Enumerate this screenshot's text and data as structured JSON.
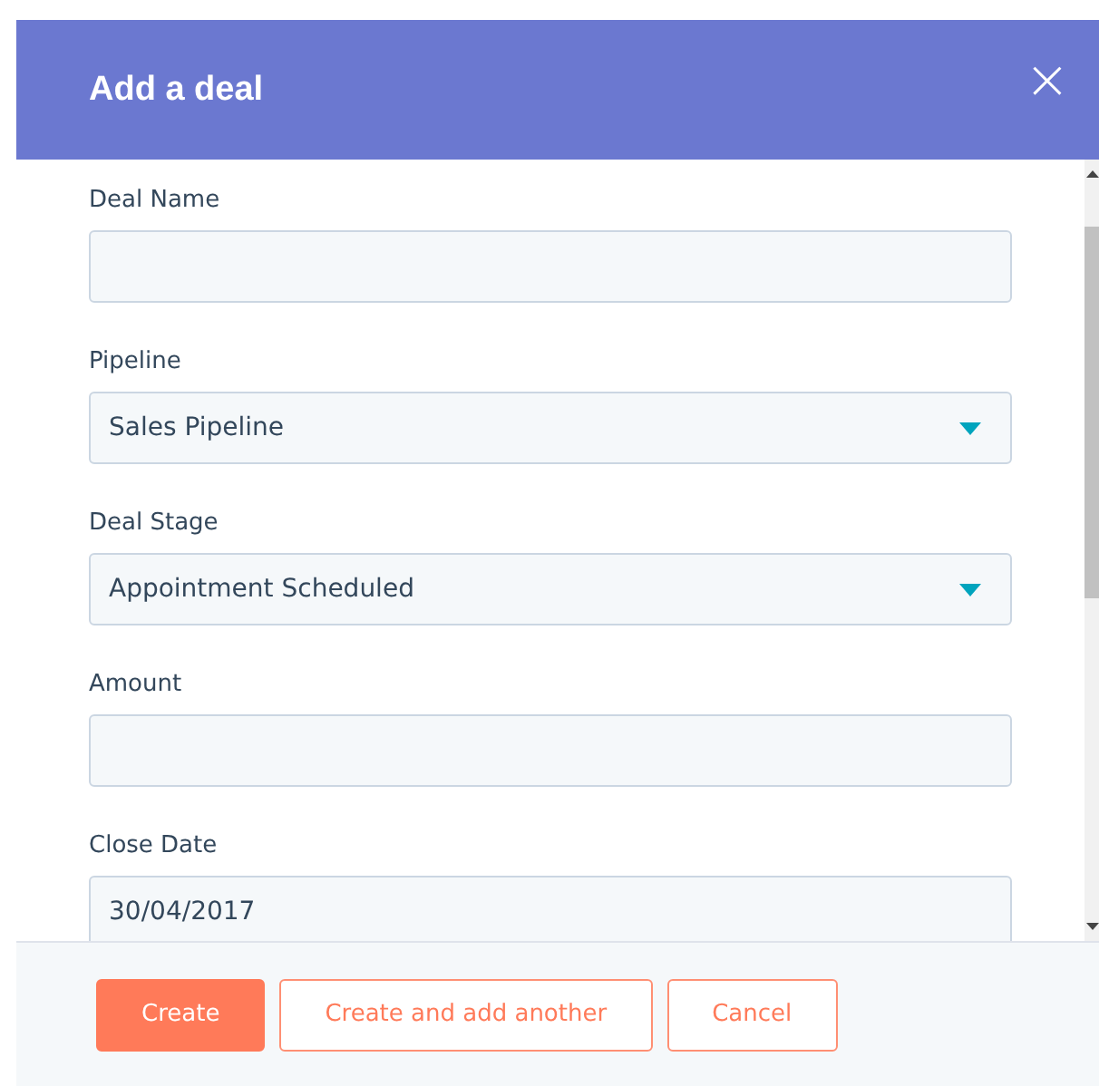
{
  "dialog": {
    "title": "Add a deal",
    "close": "×"
  },
  "fields": [
    {
      "label": "Deal Name",
      "kind": "text"
    },
    {
      "label": "Pipeline",
      "kind": "select",
      "value": "Sales Pipeline"
    },
    {
      "label": "Deal Stage",
      "kind": "select",
      "value": "Appointment Scheduled"
    },
    {
      "label": "Amount",
      "kind": "text"
    },
    {
      "label": "Close Date",
      "kind": "text",
      "value": "30/04/2017"
    }
  ],
  "buttons": [
    {
      "label": "Create",
      "kind": "primary"
    },
    {
      "label": "Create and add another",
      "kind": "secondary"
    },
    {
      "label": "Cancel",
      "kind": "secondary"
    }
  ]
}
